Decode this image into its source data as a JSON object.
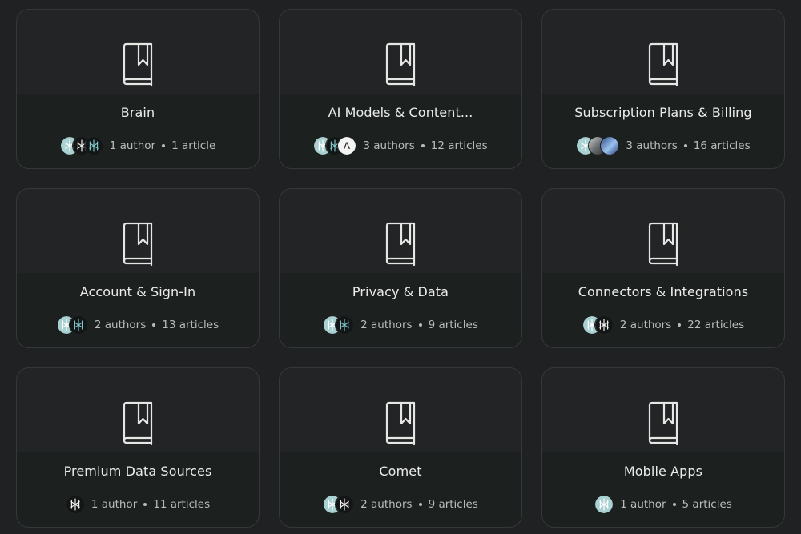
{
  "collections": [
    {
      "title": "Brain",
      "authors": "1 author",
      "articles": "1 article",
      "avatars": [
        "logo-teal",
        "logo-white-dark",
        "logo-teal-dark"
      ]
    },
    {
      "title": "AI Models & Content...",
      "authors": "3 authors",
      "articles": "12 articles",
      "avatars": [
        "logo-teal",
        "logo-teal-dark",
        "letter-a"
      ]
    },
    {
      "title": "Subscription Plans & Billing",
      "authors": "3 authors",
      "articles": "16 articles",
      "avatars": [
        "logo-teal",
        "photo-gray",
        "photo-blue"
      ]
    },
    {
      "title": "Account & Sign-In",
      "authors": "2 authors",
      "articles": "13 articles",
      "avatars": [
        "logo-teal",
        "logo-teal-dark"
      ]
    },
    {
      "title": "Privacy & Data",
      "authors": "2 authors",
      "articles": "9 articles",
      "avatars": [
        "logo-teal",
        "logo-teal-dark"
      ]
    },
    {
      "title": "Connectors & Integrations",
      "authors": "2 authors",
      "articles": "22 articles",
      "avatars": [
        "logo-teal",
        "logo-white-dark"
      ]
    },
    {
      "title": "Premium Data Sources",
      "authors": "1 author",
      "articles": "11 articles",
      "avatars": [
        "logo-white-dark"
      ]
    },
    {
      "title": "Comet",
      "authors": "2 authors",
      "articles": "9 articles",
      "avatars": [
        "logo-teal",
        "logo-white-dark"
      ]
    },
    {
      "title": "Mobile Apps",
      "authors": "1 author",
      "articles": "5 articles",
      "avatars": [
        "logo-teal"
      ]
    }
  ],
  "avatar_letter": "A",
  "colors": {
    "background": "#202122",
    "card_top": "#222425",
    "card_bottom": "#1c2120",
    "card_border": "#35383a",
    "teal": "#9cc8c8",
    "text": "#ececea",
    "muted": "#b9bcbb"
  },
  "icons": {
    "card": "book-bookmark-icon"
  }
}
